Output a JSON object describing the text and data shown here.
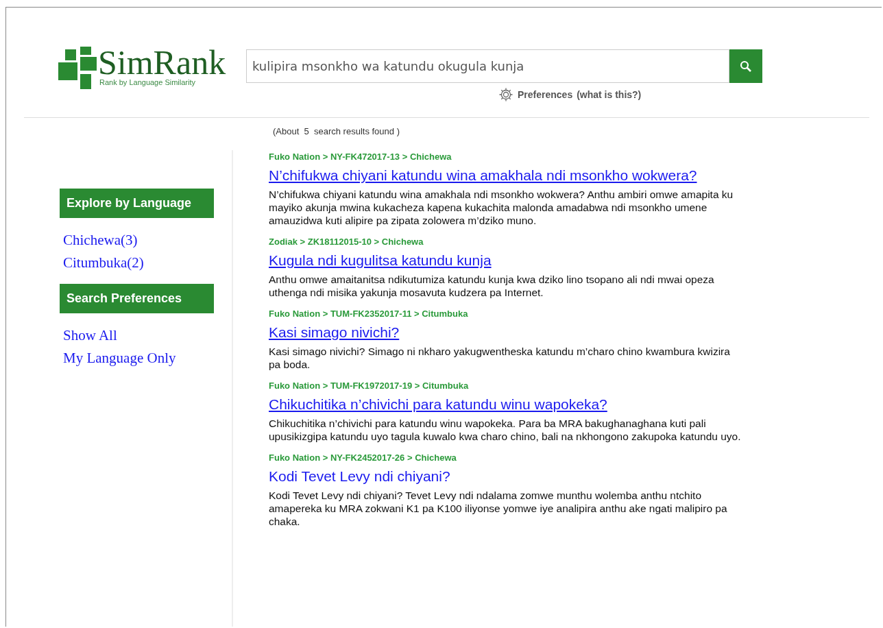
{
  "logo": {
    "name": "SimRank",
    "tagline": "Rank by Language Similarity"
  },
  "search": {
    "value": "kulipira msonkho wa katundu okugula kunja"
  },
  "preferences": {
    "label": "Preferences",
    "hint": "(what is this?)"
  },
  "summary": {
    "prefix": "(About",
    "count": "5",
    "suffix": "search results found )"
  },
  "sidebar": [
    {
      "heading": "Explore by Language",
      "links": [
        "Chichewa(3)",
        "Citumbuka(2)"
      ]
    },
    {
      "heading": "Search Preferences",
      "links": [
        "Show All",
        "My Language Only"
      ]
    }
  ],
  "results": [
    {
      "breadcrumb": "Fuko Nation > NY-FK472017-13 > Chichewa",
      "title": "N’chifukwa chiyani katundu wina amakhala ndi msonkho wokwera?",
      "underlined": true,
      "snippet": "N’chifukwa chiyani katundu wina amakhala ndi msonkho wokwera? Anthu ambiri omwe amapita ku mayiko akunja mwina kukacheza kapena kukachita malonda amadabwa ndi msonkho umene amauzidwa kuti alipire pa zipata zolowera m’dziko muno."
    },
    {
      "breadcrumb": "Zodiak > ZK18112015-10 > Chichewa",
      "title": "Kugula ndi kugulitsa katundu kunja",
      "underlined": true,
      "snippet": "Anthu omwe amaitanitsa ndikutumiza katundu kunja kwa dziko lino tsopano ali ndi mwai opeza uthenga ndi misika yakunja mosavuta kudzera pa Internet."
    },
    {
      "breadcrumb": "Fuko Nation > TUM-FK2352017-11 > Citumbuka",
      "title": "Kasi simago nivichi?",
      "underlined": true,
      "snippet": "Kasi simago nivichi? Simago ni nkharo yakugwentheska katundu m’charo chino kwambura kwizira pa boda."
    },
    {
      "breadcrumb": "Fuko Nation > TUM-FK1972017-19 > Citumbuka",
      "title": "Chikuchitika n’chivichi para katundu winu wapokeka?",
      "underlined": true,
      "snippet": "Chikuchitika n’chivichi para katundu winu wapokeka. Para ba MRA bakughanaghana kuti pali upusikizgipa katundu uyo tagula kuwalo kwa charo chino, bali na nkhongono zakupoka katundu uyo."
    },
    {
      "breadcrumb": "Fuko Nation > NY-FK2452017-26 > Chichewa",
      "title": "Kodi Tevet Levy ndi chiyani?",
      "underlined": false,
      "snippet": "Kodi Tevet Levy ndi chiyani? Tevet Levy ndi ndalama zomwe munthu wolemba anthu ntchito amapereka ku MRA zokwani K1 pa K100 iliyonse yomwe iye analipira anthu ake ngati malipiro pa chaka."
    }
  ]
}
